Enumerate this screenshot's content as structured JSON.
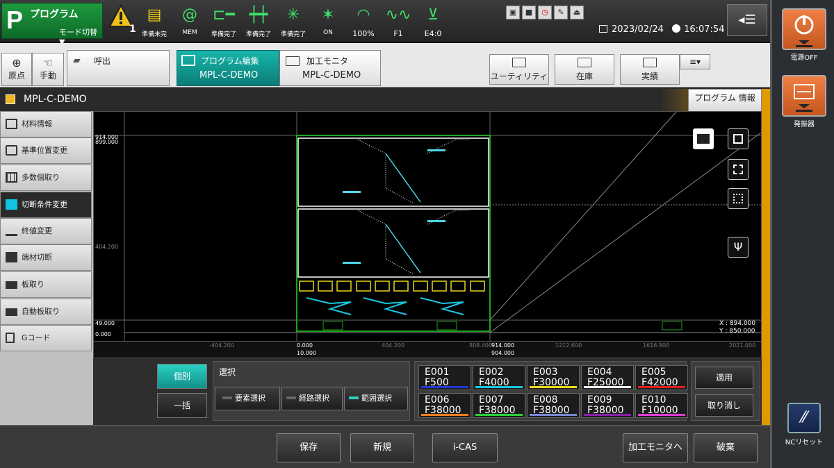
{
  "mode": {
    "letter": "P",
    "title": "プログラム",
    "switch_label": "モード切替▼"
  },
  "alarm": {
    "count": "1"
  },
  "status": [
    "準備未完",
    "MEM",
    "準備完了",
    "準備完了",
    "準備完了",
    "ON",
    "100%",
    "F1",
    "E4:0"
  ],
  "datetime": {
    "date": "2023/02/24",
    "time": "16:07:54"
  },
  "tabs": {
    "origin": "原点",
    "manual": "手動",
    "call": "呼出",
    "edit_label": "プログラム編集",
    "edit_sub": "MPL-C-DEMO",
    "monitor_label": "加工モニタ",
    "monitor_sub": "MPL-C-DEMO",
    "utility": "ユーティリティ",
    "stock": "在庫",
    "results": "実績"
  },
  "title": "MPL-C-DEMO",
  "program_info": "プログラム 情報",
  "sidebar": [
    "材料情報",
    "基準位置変更",
    "多数個取り",
    "切断条件変更",
    "終値変更",
    "端材切断",
    "板取り",
    "自動板取り",
    "Gコード"
  ],
  "canvas": {
    "y_labels": [
      "914.000",
      "899.000",
      "404.200",
      "49.000",
      "0.000"
    ],
    "x_labels": [
      "-404.200",
      "0.000",
      "404.200",
      "808.400",
      "914.000",
      "1212.600",
      "1616.800",
      "2021.000"
    ],
    "x_sub_labels": [
      "10.000",
      "904.000"
    ],
    "coord_x": "X : 894.000",
    "coord_y": "Y : 850.000"
  },
  "bottom": {
    "individual": "個別",
    "batch": "一括",
    "select_title": "選択",
    "element_select": "要素選択",
    "path_select": "経路選択",
    "range_select": "範囲選択",
    "apply": "適用",
    "cancel": "取り消し",
    "e_cells": [
      {
        "e": "E001",
        "f": "F500",
        "color": "#1f3bd1"
      },
      {
        "e": "E002",
        "f": "F4000",
        "color": "#19c6e0"
      },
      {
        "e": "E003",
        "f": "F30000",
        "color": "#e8d81a"
      },
      {
        "e": "E004",
        "f": "F25000",
        "color": "#f2f2f2"
      },
      {
        "e": "E005",
        "f": "F42000",
        "color": "#e0201b"
      },
      {
        "e": "E006",
        "f": "F38000",
        "color": "#f07f22"
      },
      {
        "e": "E007",
        "f": "F38000",
        "color": "#2bd13b"
      },
      {
        "e": "E008",
        "f": "F38000",
        "color": "#7a86d8"
      },
      {
        "e": "E009",
        "f": "F38000",
        "color": "#8a1ea8"
      },
      {
        "e": "E010",
        "f": "F10000",
        "color": "#e03cd8"
      }
    ]
  },
  "footer": {
    "save": "保存",
    "new": "新規",
    "icas": "i-CAS",
    "to_monitor": "加工モニタへ",
    "discard": "破棄"
  },
  "right": {
    "power_off": "電源OFF",
    "oscillator": "発振器",
    "nc_reset": "NCリセット"
  }
}
